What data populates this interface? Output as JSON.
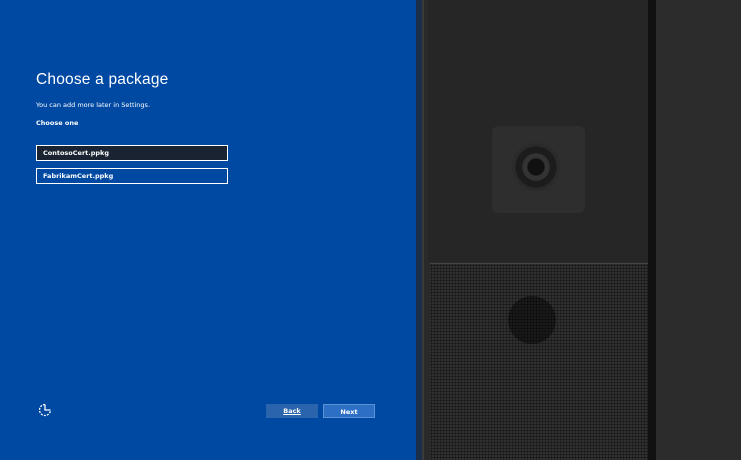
{
  "page": {
    "title": "Choose a package",
    "subtitle": "You can add more later in Settings.",
    "choose_label": "Choose one"
  },
  "options": [
    {
      "label": "ContosoCert.ppkg",
      "selected": true
    },
    {
      "label": "FabrikamCert.ppkg",
      "selected": false
    }
  ],
  "footer": {
    "back_label": "Back",
    "next_label": "Next",
    "accessibility_icon": "ease-of-access-icon"
  },
  "colors": {
    "background": "#0049a3",
    "selected": "#1a2332"
  }
}
